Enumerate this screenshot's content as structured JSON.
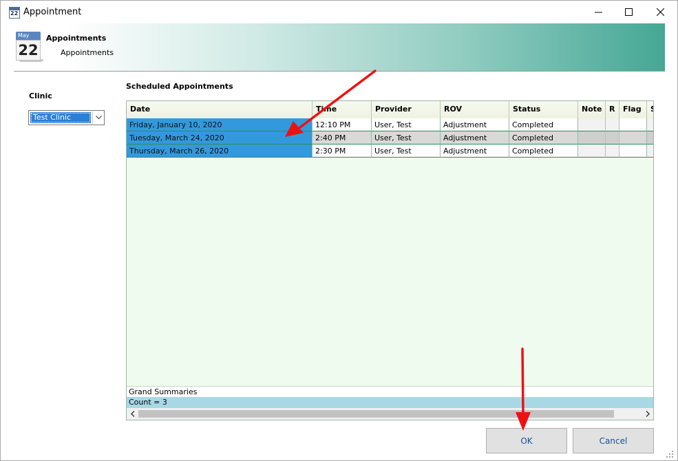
{
  "window": {
    "title": "Appointment",
    "icon_number": "22",
    "controls": {
      "minimize": "minimize-icon",
      "maximize": "maximize-icon",
      "close": "close-icon"
    }
  },
  "banner": {
    "calendar_month": "May",
    "calendar_day": "22",
    "title": "Appointments",
    "subtitle": "Appointments",
    "gradient_end_color": "#45a795"
  },
  "clinic": {
    "label": "Clinic",
    "selected": "Test Clinic"
  },
  "appointments": {
    "label": "Scheduled Appointments",
    "columns": [
      "Date",
      "Time",
      "Provider",
      "ROV",
      "Status",
      "Note",
      "R",
      "Flag",
      "S"
    ],
    "rows": [
      {
        "date": "Friday, January 10, 2020",
        "time": "12:10 PM",
        "provider": "User, Test",
        "rov": "Adjustment",
        "status": "Completed"
      },
      {
        "date": "Tuesday, March 24, 2020",
        "time": "2:40 PM",
        "provider": "User, Test",
        "rov": "Adjustment",
        "status": "Completed"
      },
      {
        "date": "Thursday, March 26, 2020",
        "time": "2:30 PM",
        "provider": "User, Test",
        "rov": "Adjustment",
        "status": "Completed"
      }
    ],
    "grand_summaries": "Grand Summaries",
    "count": "Count = 3",
    "selected_color": "#3399dd"
  },
  "buttons": {
    "ok": "OK",
    "cancel": "Cancel"
  },
  "annotation_color": "#ee1111"
}
